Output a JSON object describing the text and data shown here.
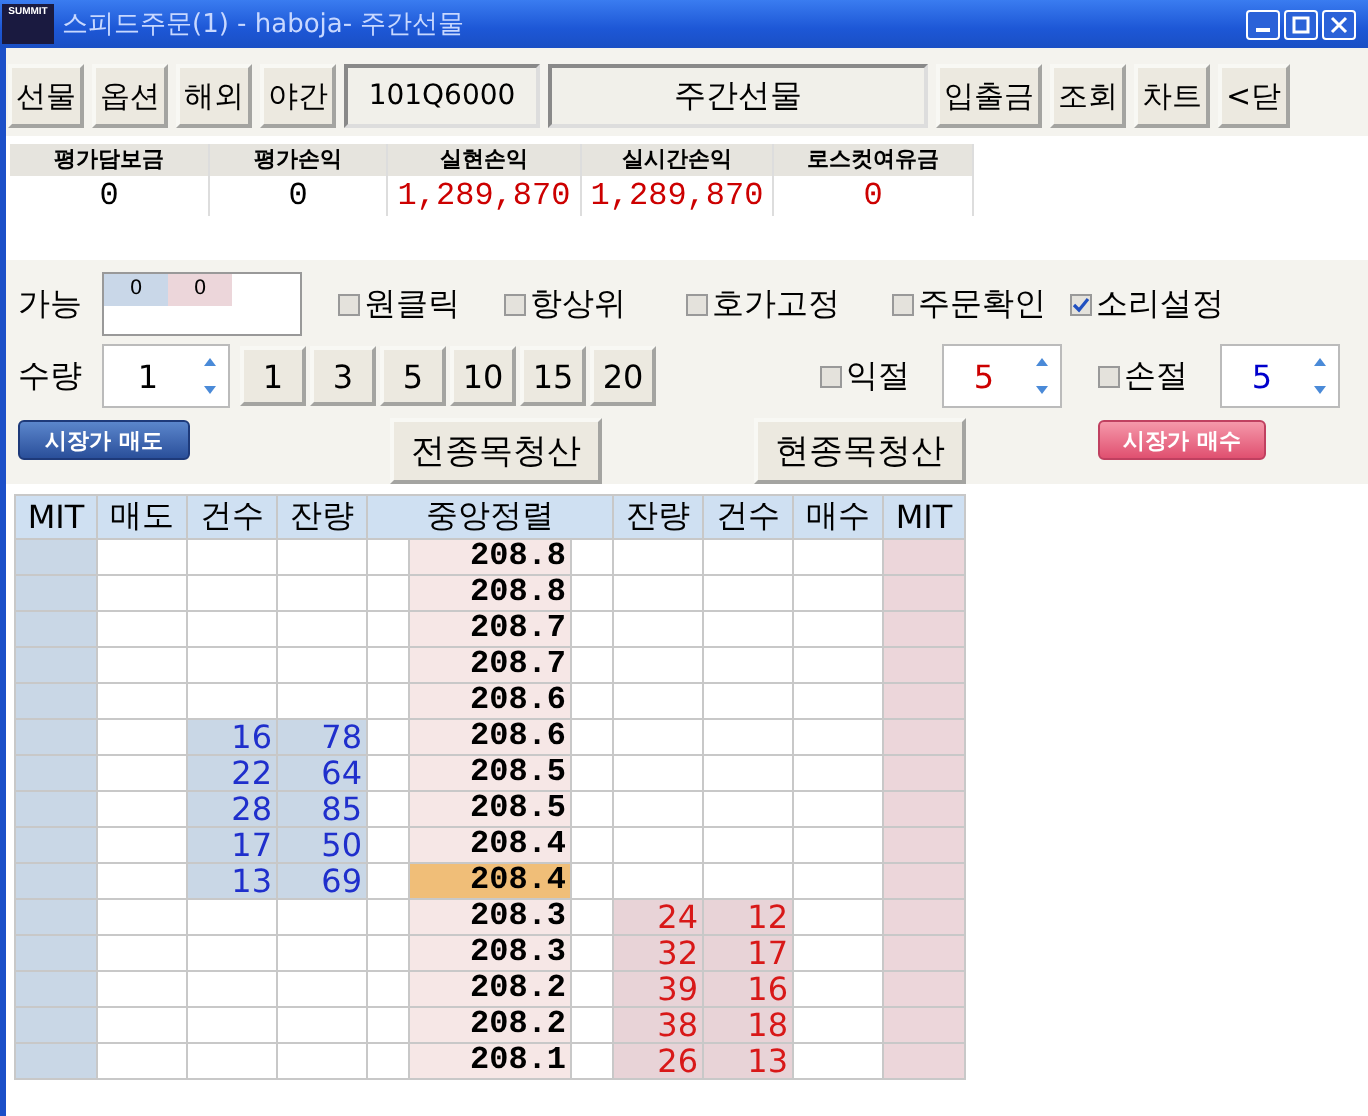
{
  "window": {
    "logo_text": "SUMMIT",
    "title": "스피드주문(1) - haboja- 주간선물"
  },
  "toolbar": [
    {
      "kind": "button",
      "label": "선물"
    },
    {
      "kind": "button",
      "label": "옵션"
    },
    {
      "kind": "button",
      "label": "해외"
    },
    {
      "kind": "button",
      "label": "야간"
    },
    {
      "kind": "code",
      "label": "101Q6000"
    },
    {
      "kind": "name",
      "label": "주간선물"
    },
    {
      "kind": "button",
      "label": "입출금"
    },
    {
      "kind": "button",
      "label": "조회"
    },
    {
      "kind": "button",
      "label": "차트"
    },
    {
      "kind": "button",
      "label": "<닫"
    }
  ],
  "summary": [
    {
      "label": "평가담보금",
      "value": "0",
      "color": "#000000"
    },
    {
      "label": "평가손익",
      "value": "0",
      "color": "#000000"
    },
    {
      "label": "실현손익",
      "value": "1,289,870",
      "color": "#cc0000"
    },
    {
      "label": "실시간손익",
      "value": "1,289,870",
      "color": "#cc0000"
    },
    {
      "label": "로스컷여유금",
      "value": "0",
      "color": "#cc0000"
    }
  ],
  "available": {
    "label": "가능",
    "sell": "0",
    "buy": "0"
  },
  "options": [
    {
      "label": "원클릭",
      "checked": false
    },
    {
      "label": "항상위",
      "checked": false
    },
    {
      "label": "호가고정",
      "checked": false
    },
    {
      "label": "주문확인",
      "checked": false
    },
    {
      "label": "소리설정",
      "checked": true
    }
  ],
  "quantity": {
    "label": "수량",
    "value": "1",
    "presets": [
      "1",
      "3",
      "5",
      "10",
      "15",
      "20"
    ]
  },
  "stops": [
    {
      "label": "익절",
      "checked": false,
      "value": "5",
      "color": "#cc0000"
    },
    {
      "label": "손절",
      "checked": false,
      "value": "5",
      "color": "#0000cc"
    }
  ],
  "actions": [
    {
      "kind": "sell",
      "label": "시장가 매도"
    },
    {
      "kind": "plain",
      "label": "전종목청산"
    },
    {
      "kind": "plain",
      "label": "현종목청산"
    },
    {
      "kind": "buy",
      "label": "시장가 매수"
    }
  ],
  "order_book": {
    "columns": [
      "MIT",
      "매도",
      "건수",
      "잔량",
      "중앙정렬",
      "잔량",
      "건수",
      "매수",
      "MIT"
    ],
    "rows": [
      {
        "price": "208.8",
        "sell_count": "",
        "sell_remaining": "",
        "buy_remaining": "",
        "buy_count": "",
        "selected": false
      },
      {
        "price": "208.8",
        "sell_count": "",
        "sell_remaining": "",
        "buy_remaining": "",
        "buy_count": "",
        "selected": false
      },
      {
        "price": "208.7",
        "sell_count": "",
        "sell_remaining": "",
        "buy_remaining": "",
        "buy_count": "",
        "selected": false
      },
      {
        "price": "208.7",
        "sell_count": "",
        "sell_remaining": "",
        "buy_remaining": "",
        "buy_count": "",
        "selected": false
      },
      {
        "price": "208.6",
        "sell_count": "",
        "sell_remaining": "",
        "buy_remaining": "",
        "buy_count": "",
        "selected": false
      },
      {
        "price": "208.6",
        "sell_count": "16",
        "sell_remaining": "78",
        "buy_remaining": "",
        "buy_count": "",
        "selected": false
      },
      {
        "price": "208.5",
        "sell_count": "22",
        "sell_remaining": "64",
        "buy_remaining": "",
        "buy_count": "",
        "selected": false
      },
      {
        "price": "208.5",
        "sell_count": "28",
        "sell_remaining": "85",
        "buy_remaining": "",
        "buy_count": "",
        "selected": false
      },
      {
        "price": "208.4",
        "sell_count": "17",
        "sell_remaining": "50",
        "buy_remaining": "",
        "buy_count": "",
        "selected": false
      },
      {
        "price": "208.4",
        "sell_count": "13",
        "sell_remaining": "69",
        "buy_remaining": "",
        "buy_count": "",
        "selected": true
      },
      {
        "price": "208.3",
        "sell_count": "",
        "sell_remaining": "",
        "buy_remaining": "24",
        "buy_count": "12",
        "selected": false
      },
      {
        "price": "208.3",
        "sell_count": "",
        "sell_remaining": "",
        "buy_remaining": "32",
        "buy_count": "17",
        "selected": false
      },
      {
        "price": "208.2",
        "sell_count": "",
        "sell_remaining": "",
        "buy_remaining": "39",
        "buy_count": "16",
        "selected": false
      },
      {
        "price": "208.2",
        "sell_count": "",
        "sell_remaining": "",
        "buy_remaining": "38",
        "buy_count": "18",
        "selected": false
      },
      {
        "price": "208.1",
        "sell_count": "",
        "sell_remaining": "",
        "buy_remaining": "26",
        "buy_count": "13",
        "selected": false
      }
    ]
  }
}
